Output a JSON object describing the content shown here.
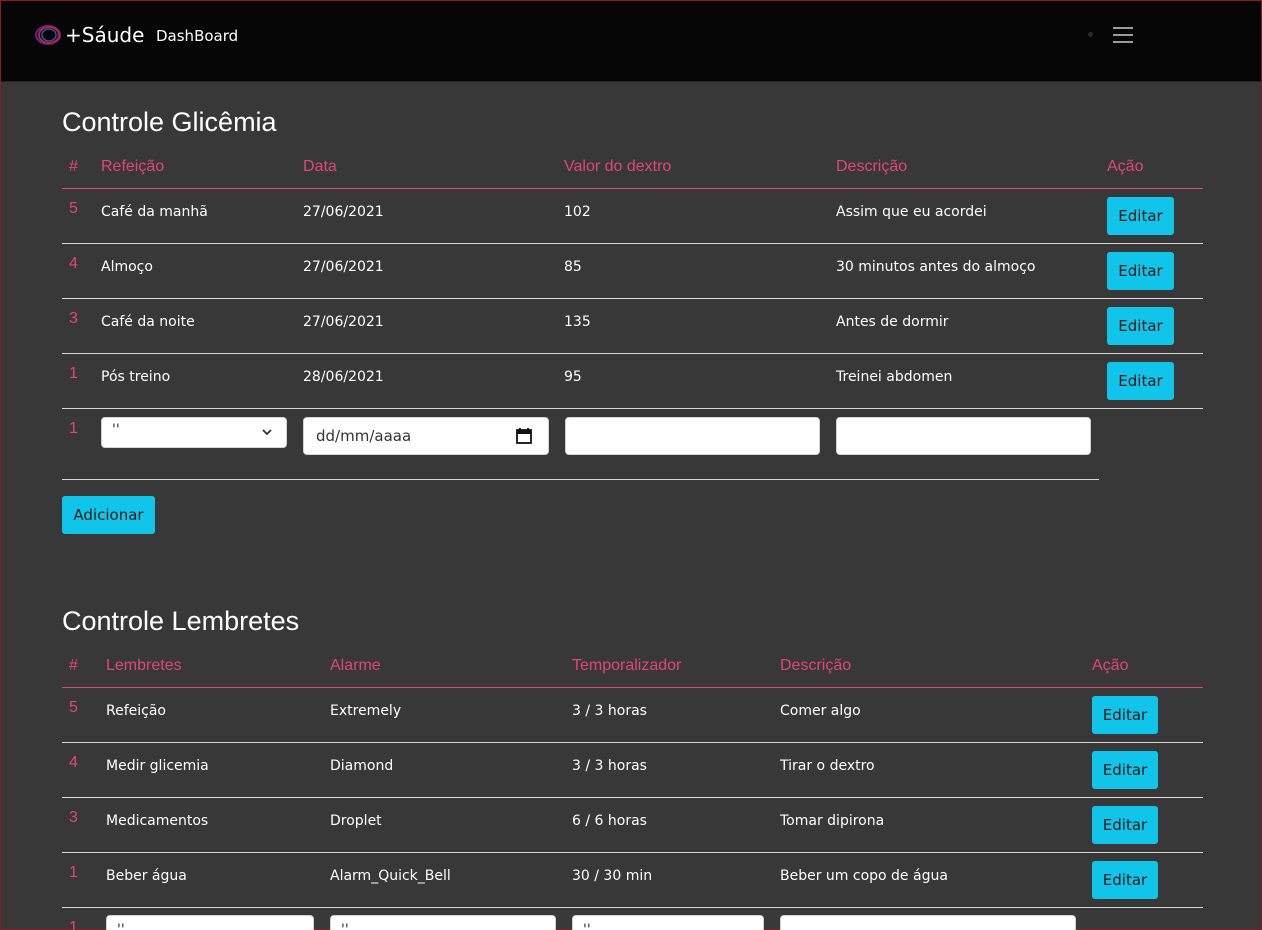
{
  "nav": {
    "brand": "+Sáude",
    "link": "DashBoard"
  },
  "glicemia": {
    "title": "Controle Glicêmia",
    "headers": [
      "#",
      "Refeição",
      "Data",
      "Valor do dextro",
      "Descrição",
      "Ação"
    ],
    "rows": [
      {
        "id": "5",
        "refeicao": "Café da manhã",
        "data": "27/06/2021",
        "valor": "102",
        "descricao": "Assim que eu acordei",
        "acao": "Editar"
      },
      {
        "id": "4",
        "refeicao": "Almoço",
        "data": "27/06/2021",
        "valor": "85",
        "descricao": "30 minutos antes do almoço",
        "acao": "Editar"
      },
      {
        "id": "3",
        "refeicao": "Café da noite",
        "data": "27/06/2021",
        "valor": "135",
        "descricao": "Antes de dormir",
        "acao": "Editar"
      },
      {
        "id": "1",
        "refeicao": "Pós treino",
        "data": "28/06/2021",
        "valor": "95",
        "descricao": "Treinei abdomen",
        "acao": "Editar"
      }
    ],
    "new_row": {
      "id": "1",
      "select_value": "''",
      "date_placeholder": "dd/mm/aaaa"
    },
    "add_button": "Adicionar"
  },
  "lembretes": {
    "title": "Controle Lembretes",
    "headers": [
      "#",
      "Lembretes",
      "Alarme",
      "Temporalizador",
      "Descrição",
      "Ação"
    ],
    "rows": [
      {
        "id": "5",
        "lembrete": "Refeição",
        "alarme": "Extremely",
        "tempo": "3 / 3 horas",
        "descricao": "Comer algo",
        "acao": "Editar"
      },
      {
        "id": "4",
        "lembrete": "Medir glicemia",
        "alarme": "Diamond",
        "tempo": "3 / 3 horas",
        "descricao": "Tirar o dextro",
        "acao": "Editar"
      },
      {
        "id": "3",
        "lembrete": "Medicamentos",
        "alarme": "Droplet",
        "tempo": "6 / 6 horas",
        "descricao": "Tomar dipirona",
        "acao": "Editar"
      },
      {
        "id": "1",
        "lembrete": "Beber água",
        "alarme": "Alarm_Quick_Bell",
        "tempo": "30 / 30 min",
        "descricao": "Beber um copo de água",
        "acao": "Editar"
      }
    ],
    "new_row": {
      "id": "1",
      "v1": "''",
      "v2": "''",
      "v3": "''"
    }
  },
  "colors": {
    "accent": "#e0457b",
    "button": "#11c5ea",
    "background": "#383838",
    "navbar": "#060606"
  }
}
